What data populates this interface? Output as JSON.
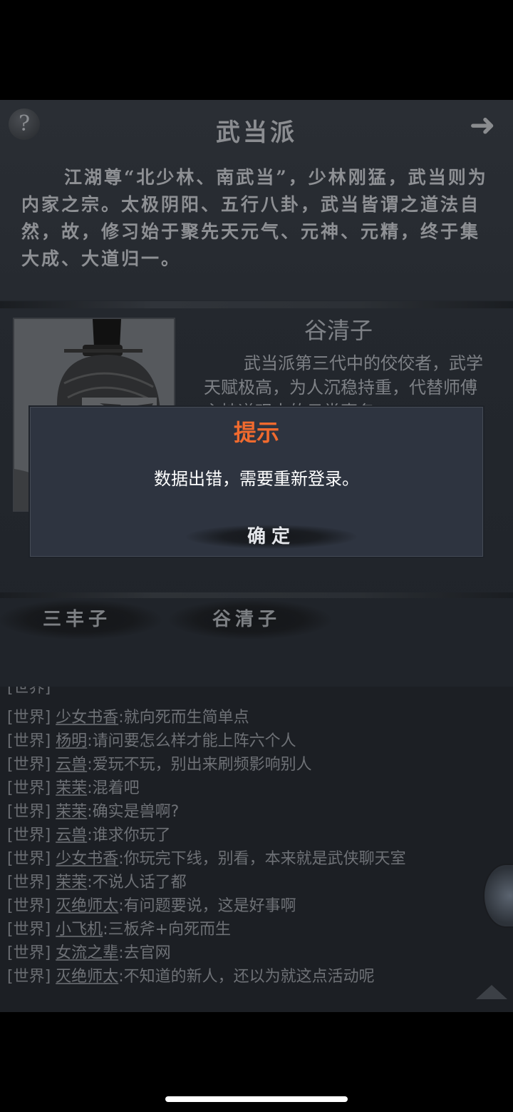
{
  "header": {
    "help_icon_glyph": "?",
    "title": "武当派",
    "next_icon_glyph": "➜"
  },
  "sect": {
    "description": "江湖尊“北少林、南武当”，少林刚猛，武当则为内家之宗。太极阴阳、五行八卦，武当皆谓之道法自然，故，修习始于聚先天元气、元神、元精，终于集大成、大道归一。"
  },
  "character": {
    "name": "谷清子",
    "description": "武当派第三代中的佼佼者，武学天赋极高，为人沉稳持重，代替师傅主持道观中的日常事务"
  },
  "masters": [
    {
      "label": "三丰子"
    },
    {
      "label": "谷清子"
    }
  ],
  "chat": {
    "messages": [
      {
        "tag": "[世界]",
        "nick": "少女书香",
        "text": ":就向死而生简单点"
      },
      {
        "tag": "[世界]",
        "nick": "杨明",
        "text": ":请问要怎么样才能上阵六个人"
      },
      {
        "tag": "[世界]",
        "nick": "云兽",
        "text": ":爱玩不玩，别出来刷频影响别人"
      },
      {
        "tag": "[世界]",
        "nick": "茉茉",
        "text": ":混着吧"
      },
      {
        "tag": "[世界]",
        "nick": "茉茉",
        "text": ":确实是兽啊?"
      },
      {
        "tag": "[世界]",
        "nick": "云兽",
        "text": ":谁求你玩了"
      },
      {
        "tag": "[世界]",
        "nick": "少女书香",
        "text": ":你玩完下线，别看，本来就是武侠聊天室"
      },
      {
        "tag": "[世界]",
        "nick": "茉茉",
        "text": ":不说人话了都"
      },
      {
        "tag": "[世界]",
        "nick": "灭绝师太",
        "text": ":有问题要说，这是好事啊"
      },
      {
        "tag": "[世界]",
        "nick": "小飞机",
        "text": ":三板斧+向死而生"
      },
      {
        "tag": "[世界]",
        "nick": "女流之辈",
        "text": ":去官网"
      },
      {
        "tag": "[世界]",
        "nick": "灭绝师太",
        "text": ":不知道的新人，还以为就这点活动呢"
      }
    ]
  },
  "dialog": {
    "title": "提示",
    "message": "数据出错，需要重新登录。",
    "confirm_label": "确定"
  },
  "colors": {
    "dialog_title": "#f06a2e",
    "dialog_bg": "#2e3440",
    "background": "#22262c"
  }
}
